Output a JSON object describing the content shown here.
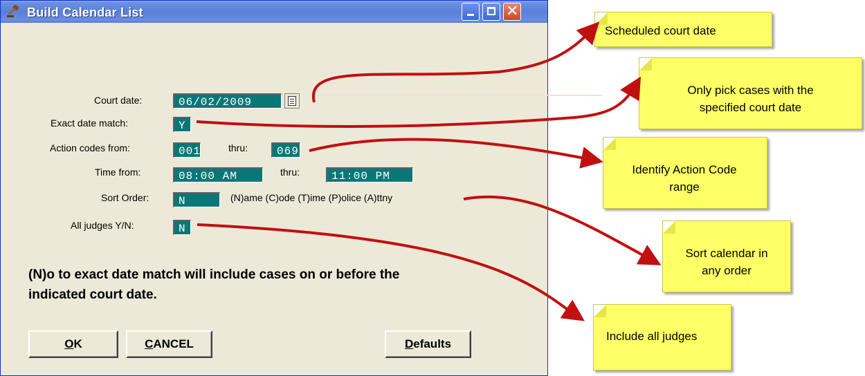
{
  "window": {
    "title": "Build Calendar List",
    "buttons": [
      "minimize",
      "maximize",
      "close"
    ],
    "close_glyph": "✕"
  },
  "form": {
    "court_date": {
      "label": "Court date:",
      "value": "06/02/2009"
    },
    "exact_match": {
      "label": "Exact date match:",
      "value": "Y"
    },
    "action_codes": {
      "label": "Action codes from:",
      "from": "001",
      "thru_label": "thru:",
      "thru": "069"
    },
    "time": {
      "label": "Time from:",
      "from": "08:00 AM",
      "thru_label": "thru:",
      "thru": "11:00 PM"
    },
    "sort_order": {
      "label": "Sort Order:",
      "value": "N",
      "hint": "(N)ame (C)ode (T)ime (P)olice (A)ttny"
    },
    "all_judges": {
      "label": "All judges Y/N:",
      "value": "N"
    }
  },
  "note": {
    "line1": "(N)o to exact date match will include cases on or before the",
    "line2": "indicated court date."
  },
  "buttons": {
    "ok": {
      "mnemonic": "O",
      "rest": "K"
    },
    "cancel": {
      "mnemonic": "C",
      "rest": "ANCEL"
    },
    "defaults": {
      "mnemonic": "D",
      "rest": "efaults"
    }
  },
  "callouts": {
    "scheduled": "Scheduled court date",
    "only_pick_1": "Only pick cases with the",
    "only_pick_2": "specified court date",
    "identify_1": "Identify Action Code",
    "identify_2": "range",
    "sort_1": "Sort calendar in",
    "sort_2": "any order",
    "judges": "Include all judges"
  },
  "colors": {
    "field_bg": "#0a7777",
    "dialog_bg": "#ece9d8",
    "callout_bg": "#ffff66",
    "arrow": "#c01010"
  }
}
